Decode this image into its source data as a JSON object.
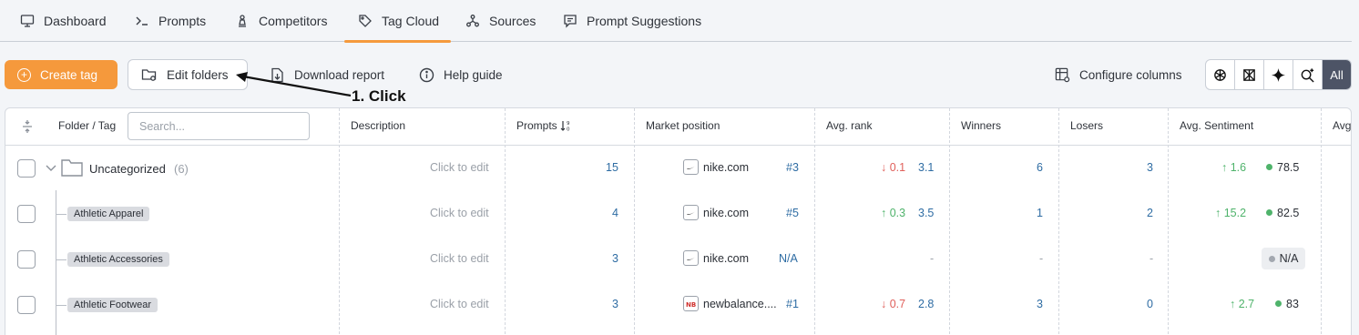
{
  "nav": {
    "tabs": [
      {
        "label": "Dashboard",
        "icon": "monitor-icon"
      },
      {
        "label": "Prompts",
        "icon": "terminal-icon"
      },
      {
        "label": "Competitors",
        "icon": "chess-pawn-icon"
      },
      {
        "label": "Tag Cloud",
        "icon": "tag-icon",
        "active": true
      },
      {
        "label": "Sources",
        "icon": "network-icon"
      },
      {
        "label": "Prompt Suggestions",
        "icon": "chat-suggestion-icon"
      }
    ]
  },
  "toolbar": {
    "create_tag": "Create tag",
    "edit_folders": "Edit folders",
    "download_report": "Download report",
    "help_guide": "Help guide",
    "configure_columns": "Configure columns",
    "models_all": "All"
  },
  "annotation": {
    "text": "1. Click"
  },
  "table": {
    "headers": {
      "folder_tag": "Folder / Tag",
      "search_placeholder": "Search...",
      "description": "Description",
      "prompts": "Prompts",
      "market_position": "Market position",
      "avg_rank": "Avg. rank",
      "winners": "Winners",
      "losers": "Losers",
      "avg_sentiment": "Avg. Sentiment",
      "more": "Avg"
    },
    "folder": {
      "name": "Uncategorized",
      "count": "(6)",
      "description": "Click to edit",
      "prompts": "15",
      "domain": "nike.com",
      "position": "#3",
      "rank_delta": "0.1",
      "rank": "3.1",
      "winners": "6",
      "losers": "3",
      "sentiment_delta": "1.6",
      "sentiment": "78.5"
    },
    "rows": [
      {
        "tag": "Athletic Apparel",
        "description": "Click to edit",
        "prompts": "4",
        "domain": "nike.com",
        "position": "#5",
        "rank_delta": "0.3",
        "rank": "3.5",
        "winners": "1",
        "losers": "2",
        "sentiment_delta": "15.2",
        "sentiment": "82.5"
      },
      {
        "tag": "Athletic Accessories",
        "description": "Click to edit",
        "prompts": "3",
        "domain": "nike.com",
        "position": "N/A",
        "rank": "-",
        "winners": "-",
        "losers": "-",
        "sentiment": "N/A"
      },
      {
        "tag": "Athletic Footwear",
        "description": "Click to edit",
        "prompts": "3",
        "domain": "newbalance....",
        "position": "#1",
        "rank_delta": "0.7",
        "rank": "2.8",
        "winners": "3",
        "losers": "0",
        "sentiment_delta": "2.7",
        "sentiment": "83"
      }
    ]
  },
  "colors": {
    "accent": "#f5993c",
    "link_blue": "#2e6ca3",
    "positive": "#4fb36b",
    "negative": "#e0605b"
  }
}
